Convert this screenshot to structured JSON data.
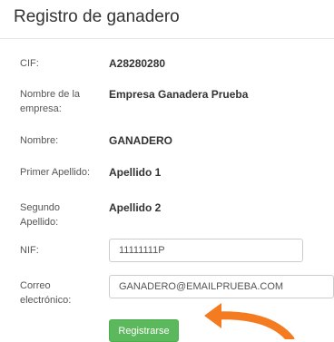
{
  "header": {
    "title": "Registro de ganadero"
  },
  "fields": {
    "cif": {
      "label": "CIF:",
      "value": "A28280280"
    },
    "company_name": {
      "label": "Nombre de la empresa:",
      "value": "Empresa Ganadera Prueba"
    },
    "name": {
      "label": "Nombre:",
      "value": "GANADERO"
    },
    "first_surname": {
      "label": "Primer Apellido:",
      "value": "Apellido 1"
    },
    "second_surname": {
      "label": "Segundo Apellido:",
      "value": "Apellido 2"
    },
    "nif": {
      "label": "NIF:",
      "value": "11111111P"
    },
    "email": {
      "label": "Correo electrónico:",
      "value": "GANADERO@EMAILPRUEBA.COM"
    }
  },
  "actions": {
    "register_label": "Registrarse"
  },
  "colors": {
    "button": "#5cb85c",
    "arrow": "#f47b20"
  },
  "icons": {
    "annotation": "curved-arrow-icon"
  }
}
